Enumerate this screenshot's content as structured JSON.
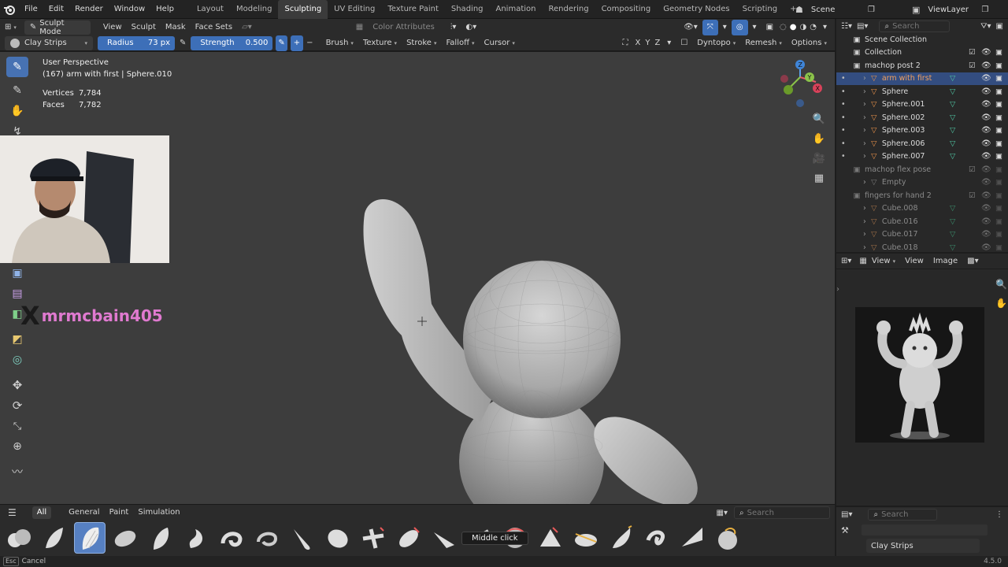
{
  "topbar": {
    "menus": [
      "File",
      "Edit",
      "Render",
      "Window",
      "Help"
    ],
    "workspaces": [
      "Layout",
      "Modeling",
      "Sculpting",
      "UV Editing",
      "Texture Paint",
      "Shading",
      "Animation",
      "Rendering",
      "Compositing",
      "Geometry Nodes",
      "Scripting"
    ],
    "active_workspace": "Sculpting",
    "add_tab": "+",
    "scene": "Scene",
    "view_layer": "ViewLayer"
  },
  "header1": {
    "mode": "Sculpt Mode",
    "menus": [
      "View",
      "Sculpt",
      "Mask",
      "Face Sets"
    ],
    "color_attributes": "Color Attributes"
  },
  "header2": {
    "brush_name": "Clay Strips",
    "radius_label": "Radius",
    "radius_value": "73 px",
    "strength_label": "Strength",
    "strength_value": "0.500",
    "dropdowns": [
      "Brush",
      "Texture",
      "Stroke",
      "Falloff",
      "Cursor"
    ],
    "axes": [
      "X",
      "Y",
      "Z"
    ],
    "dyntopo": "Dyntopo",
    "remesh": "Remesh",
    "options": "Options"
  },
  "overlay": {
    "perspective": "User Perspective",
    "object_info": "(167) arm with first | Sphere.010",
    "vertices_label": "Vertices",
    "vertices_value": "7,784",
    "faces_label": "Faces",
    "faces_value": "7,782",
    "watermark": "mrmcbain405"
  },
  "gizmo": {
    "z": "Z",
    "y": "Y",
    "x": "X"
  },
  "outliner": {
    "search_placeholder": "Search",
    "root": "Scene Collection",
    "rows": [
      {
        "label": "Collection",
        "indent": 1,
        "type": "collection"
      },
      {
        "label": "machop post 2",
        "indent": 1,
        "type": "collection"
      },
      {
        "label": "arm with first",
        "indent": 2,
        "type": "mesh",
        "selected": true
      },
      {
        "label": "Sphere",
        "indent": 2,
        "type": "mesh"
      },
      {
        "label": "Sphere.001",
        "indent": 2,
        "type": "mesh"
      },
      {
        "label": "Sphere.002",
        "indent": 2,
        "type": "mesh"
      },
      {
        "label": "Sphere.003",
        "indent": 2,
        "type": "mesh"
      },
      {
        "label": "Sphere.006",
        "indent": 2,
        "type": "mesh"
      },
      {
        "label": "Sphere.007",
        "indent": 2,
        "type": "mesh"
      },
      {
        "label": "machop flex pose",
        "indent": 1,
        "type": "collection",
        "dim": true
      },
      {
        "label": "Empty",
        "indent": 2,
        "type": "empty",
        "dim": true
      },
      {
        "label": "fingers for hand 2",
        "indent": 1,
        "type": "collection",
        "dim": true
      },
      {
        "label": "Cube.008",
        "indent": 2,
        "type": "mesh",
        "dim": true
      },
      {
        "label": "Cube.016",
        "indent": 2,
        "type": "mesh",
        "dim": true
      },
      {
        "label": "Cube.017",
        "indent": 2,
        "type": "mesh",
        "dim": true
      },
      {
        "label": "Cube.018",
        "indent": 2,
        "type": "mesh",
        "dim": true
      }
    ]
  },
  "image_editor": {
    "menus": [
      "View",
      "View",
      "Image"
    ]
  },
  "properties": {
    "search_placeholder": "Search",
    "brush": "Clay Strips"
  },
  "shelf": {
    "tabs": [
      "All",
      "General",
      "Paint",
      "Simulation"
    ],
    "active_tab": "All",
    "search_placeholder": "Search",
    "tooltip": "Middle click"
  },
  "status": {
    "key": "Esc",
    "action": "Cancel",
    "version": "4.5.0"
  },
  "colors": {
    "accent": "#3d6fb8",
    "active_workspace_bg": "#3b3b3b",
    "viewport_bg": "#3d3d3d",
    "watermark": "#e07ad0",
    "mesh_icon": "#e8914a",
    "modifier_icon": "#4fc3a1"
  }
}
